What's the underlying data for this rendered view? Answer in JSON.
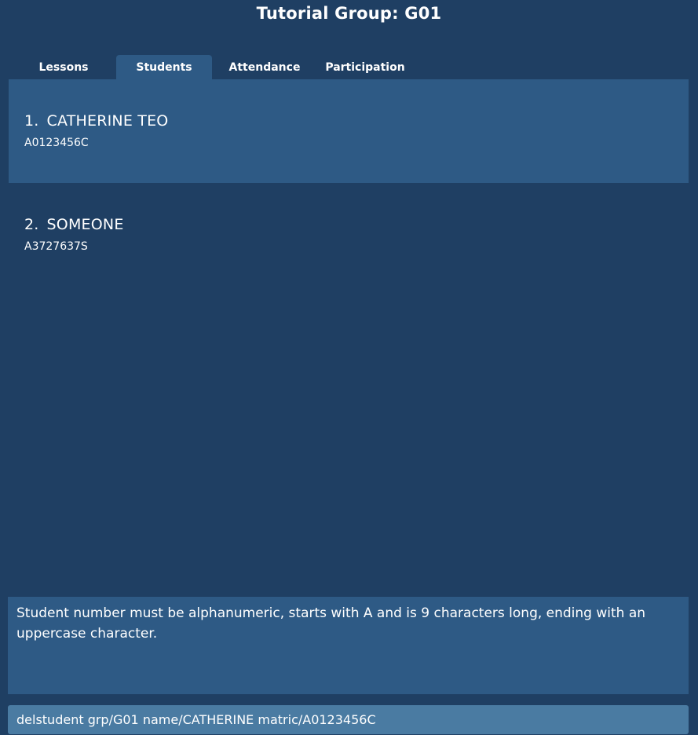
{
  "header": {
    "title": "Tutorial Group: G01"
  },
  "tabs": [
    {
      "label": "Lessons",
      "active": false
    },
    {
      "label": "Students",
      "active": true
    },
    {
      "label": "Attendance",
      "active": false
    },
    {
      "label": "Participation",
      "active": false
    }
  ],
  "students": [
    {
      "index": "1.",
      "name": "CATHERINE TEO",
      "matric": "A0123456C"
    },
    {
      "index": "2.",
      "name": "SOMEONE",
      "matric": "A3727637S"
    }
  ],
  "result_display": {
    "message": "Student number must be alphanumeric, starts with A and is 9 characters long, ending with an uppercase character."
  },
  "command_box": {
    "value": "delstudent grp/G01 name/CATHERINE matric/A0123456C"
  },
  "colors": {
    "background": "#1f3f63",
    "panel": "#2e5a85",
    "command_box": "#4a7ba2"
  }
}
